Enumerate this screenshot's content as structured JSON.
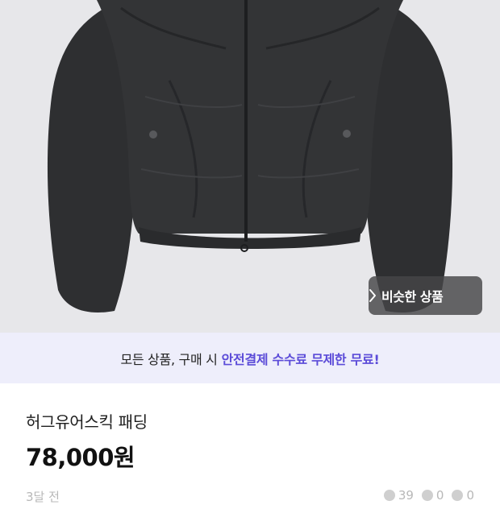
{
  "product": {
    "image_alt": "black puffer jacket",
    "title": "허그유어스킥 패딩",
    "price": "78,000원"
  },
  "similar_button": {
    "label": "비슷한 상품",
    "icon": "chevron-right-icon"
  },
  "banner": {
    "plain_text": "모든 상품, 구매 시",
    "highlight_text": "안전결제 수수료 무제한 무료!",
    "highlight_color": "#5b4bd8"
  },
  "meta": {
    "time_ago": "3달 전",
    "views": "39",
    "likes": "0",
    "chats": "0"
  }
}
